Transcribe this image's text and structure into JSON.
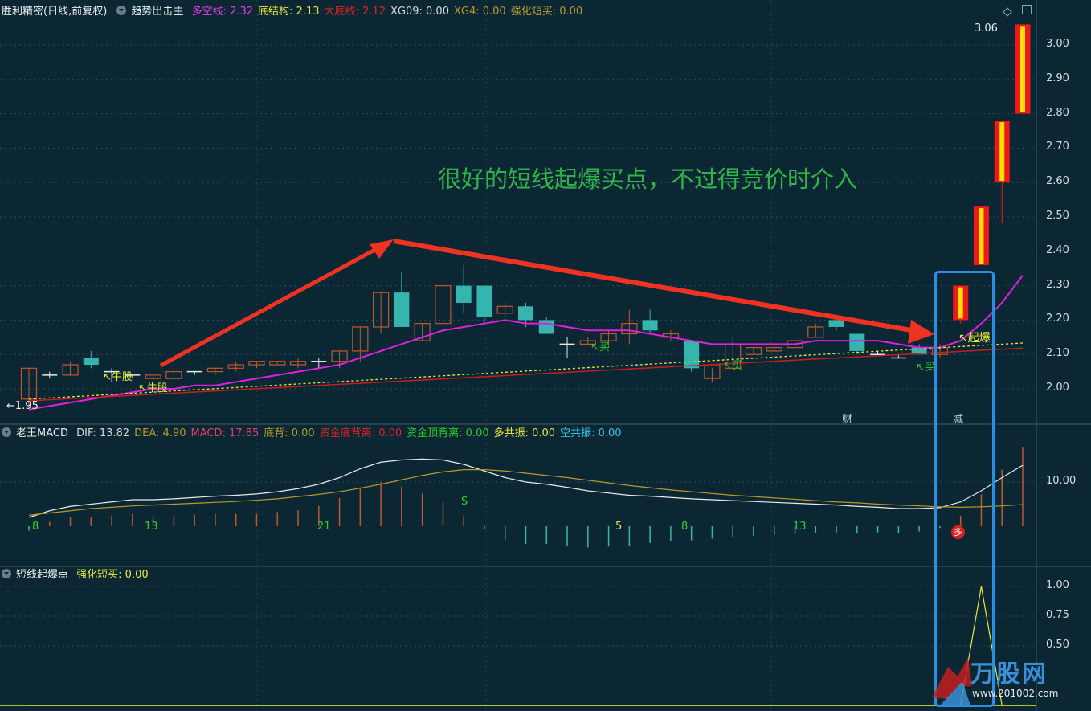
{
  "header_main": {
    "title": "胜利精密(日线,前复权)",
    "indicator": "趋势出击主",
    "items": [
      {
        "label": "多空线:",
        "value": "2.32",
        "color": "#e840e8"
      },
      {
        "label": "底结构:",
        "value": "2.13",
        "color": "#e8e83a"
      },
      {
        "label": "大底线:",
        "value": "2.12",
        "color": "#e02424"
      },
      {
        "label": "XG09:",
        "value": "0.00",
        "color": "#d8d8d8"
      },
      {
        "label": "XG4:",
        "value": "0.00",
        "color": "#b89a2a"
      },
      {
        "label": "强化短买:",
        "value": "0.00",
        "color": "#b89a2a"
      }
    ]
  },
  "header_macd": {
    "title": "老王MACD",
    "items": [
      {
        "label": "DIF:",
        "value": "13.82",
        "color": "#d8d8d8"
      },
      {
        "label": "DEA:",
        "value": "4.90",
        "color": "#b8982a"
      },
      {
        "label": "MACD:",
        "value": "17.85",
        "color": "#e0406e"
      },
      {
        "label": "底背:",
        "value": "0.00",
        "color": "#b89a2a"
      },
      {
        "label": "资金底背离:",
        "value": "0.00",
        "color": "#e02424"
      },
      {
        "label": "资金顶背离:",
        "value": "0.00",
        "color": "#28d028"
      },
      {
        "label": "多共振:",
        "value": "0.00",
        "color": "#e8e83a"
      },
      {
        "label": "空共振:",
        "value": "0.00",
        "color": "#28c8e8"
      }
    ]
  },
  "header_burst": {
    "title": "短线起爆点",
    "items": [
      {
        "label": "强化短买:",
        "value": "0.00",
        "color": "#e8e83a"
      }
    ]
  },
  "price_axis": [
    "3.00",
    "2.90",
    "2.80",
    "2.70",
    "2.60",
    "2.50",
    "2.40",
    "2.30",
    "2.20",
    "2.10",
    "2.00"
  ],
  "macd_axis": [
    "10.00"
  ],
  "burst_axis": [
    "1.00",
    "0.75",
    "0.50"
  ],
  "annotation": "很好的短线起爆买点，不过得竞价时介入",
  "signals": {
    "niu1": "牛股",
    "niu2": "牛股",
    "buy1": "买",
    "buy2": "买",
    "buy3": "买",
    "qibao": "起爆",
    "cai": "财",
    "jian": "减",
    "duo": "多",
    "high": "3.06",
    "low": "1.95"
  },
  "macd_counts": [
    "8",
    "13",
    "21",
    "S",
    "5",
    "8",
    "13"
  ],
  "watermark": {
    "brand": "万股网",
    "url": "www.201002.com"
  },
  "colors": {
    "background": "#0b2734",
    "up": "#c2572c",
    "down": "#36b5ae",
    "limit_up_border": "#f01818",
    "limit_up_fill": "#ffe000",
    "ma_line": "#e020e0",
    "selection_box": "#2a8fe3"
  },
  "chart_data": {
    "type": "candlestick",
    "ylim": [
      1.92,
      3.08
    ],
    "ohlc": [
      [
        1.97,
        2.06,
        1.95,
        2.06
      ],
      [
        2.04,
        2.05,
        2.03,
        2.04
      ],
      [
        2.04,
        2.08,
        2.04,
        2.07
      ],
      [
        2.09,
        2.11,
        2.06,
        2.07
      ],
      [
        2.05,
        2.06,
        2.02,
        2.05
      ],
      [
        2.04,
        2.04,
        2.03,
        2.04
      ],
      [
        2.03,
        2.04,
        2.02,
        2.04
      ],
      [
        2.03,
        2.06,
        2.03,
        2.05
      ],
      [
        2.05,
        2.05,
        2.04,
        2.05
      ],
      [
        2.05,
        2.06,
        2.04,
        2.06
      ],
      [
        2.06,
        2.08,
        2.05,
        2.07
      ],
      [
        2.07,
        2.08,
        2.06,
        2.08
      ],
      [
        2.07,
        2.08,
        2.07,
        2.08
      ],
      [
        2.07,
        2.09,
        2.06,
        2.08
      ],
      [
        2.08,
        2.09,
        2.06,
        2.08
      ],
      [
        2.08,
        2.11,
        2.06,
        2.11
      ],
      [
        2.11,
        2.18,
        2.08,
        2.18
      ],
      [
        2.18,
        2.28,
        2.16,
        2.28
      ],
      [
        2.28,
        2.34,
        2.18,
        2.18
      ],
      [
        2.14,
        2.19,
        2.14,
        2.19
      ],
      [
        2.19,
        2.3,
        2.19,
        2.3
      ],
      [
        2.3,
        2.36,
        2.22,
        2.25
      ],
      [
        2.3,
        2.3,
        2.19,
        2.21
      ],
      [
        2.22,
        2.25,
        2.21,
        2.24
      ],
      [
        2.24,
        2.25,
        2.18,
        2.2
      ],
      [
        2.2,
        2.21,
        2.16,
        2.16
      ],
      [
        2.13,
        2.15,
        2.09,
        2.13
      ],
      [
        2.13,
        2.15,
        2.13,
        2.14
      ],
      [
        2.14,
        2.17,
        2.12,
        2.16
      ],
      [
        2.16,
        2.23,
        2.13,
        2.19
      ],
      [
        2.2,
        2.23,
        2.16,
        2.17
      ],
      [
        2.15,
        2.17,
        2.14,
        2.16
      ],
      [
        2.14,
        2.14,
        2.05,
        2.06
      ],
      [
        2.03,
        2.06,
        2.02,
        2.07
      ],
      [
        2.06,
        2.15,
        2.06,
        2.13
      ],
      [
        2.1,
        2.12,
        2.1,
        2.12
      ],
      [
        2.11,
        2.13,
        2.11,
        2.12
      ],
      [
        2.12,
        2.15,
        2.12,
        2.14
      ],
      [
        2.15,
        2.19,
        2.15,
        2.18
      ],
      [
        2.2,
        2.2,
        2.17,
        2.18
      ],
      [
        2.16,
        2.16,
        2.1,
        2.11
      ],
      [
        2.1,
        2.11,
        2.1,
        2.1
      ],
      [
        2.09,
        2.1,
        2.09,
        2.09
      ],
      [
        2.12,
        2.13,
        2.1,
        2.1
      ],
      [
        2.1,
        2.13,
        2.09,
        2.12
      ],
      [
        2.2,
        2.3,
        2.19,
        2.3
      ],
      [
        2.36,
        2.53,
        2.36,
        2.53
      ],
      [
        2.6,
        2.78,
        2.48,
        2.78
      ],
      [
        2.8,
        3.06,
        2.8,
        3.06
      ]
    ],
    "ma": [
      1.94,
      1.95,
      1.96,
      1.97,
      1.98,
      1.99,
      2.0,
      2.0,
      2.01,
      2.01,
      2.02,
      2.03,
      2.04,
      2.05,
      2.06,
      2.07,
      2.09,
      2.11,
      2.13,
      2.15,
      2.17,
      2.18,
      2.19,
      2.2,
      2.19,
      2.19,
      2.18,
      2.17,
      2.17,
      2.17,
      2.16,
      2.15,
      2.14,
      2.13,
      2.13,
      2.13,
      2.13,
      2.13,
      2.14,
      2.14,
      2.14,
      2.14,
      2.13,
      2.12,
      2.12,
      2.14,
      2.19,
      2.25,
      2.33
    ],
    "macd_dif": [
      2,
      3.5,
      4.5,
      5,
      5.5,
      6,
      6,
      6.2,
      6.5,
      6.8,
      7,
      7.3,
      7.8,
      8.5,
      9.5,
      11,
      13,
      14.5,
      15,
      15.2,
      15,
      14,
      12.5,
      11,
      10,
      9.5,
      8.8,
      8,
      7.5,
      7,
      6.8,
      6.5,
      6.2,
      6,
      5.8,
      5.6,
      5.4,
      5.2,
      5,
      4.8,
      4.5,
      4.3,
      4,
      4,
      4.2,
      5.5,
      8,
      11,
      13.8
    ],
    "macd_dea": [
      2.5,
      3,
      3.5,
      4,
      4.3,
      4.6,
      4.8,
      5,
      5.2,
      5.4,
      5.6,
      5.9,
      6.2,
      6.7,
      7.2,
      7.8,
      8.6,
      9.5,
      10.5,
      11.5,
      12.3,
      12.8,
      12.8,
      12.5,
      12,
      11.5,
      11,
      10.4,
      9.8,
      9.2,
      8.7,
      8.2,
      7.8,
      7.4,
      7,
      6.7,
      6.4,
      6.1,
      5.8,
      5.5,
      5.3,
      5,
      4.8,
      4.6,
      4.4,
      4.3,
      4.4,
      4.6,
      4.9
    ],
    "burst": [
      0,
      0,
      0,
      0,
      0,
      0,
      0,
      0,
      0,
      0,
      0,
      0,
      0,
      0,
      0,
      0,
      0,
      0,
      0,
      0,
      0,
      0,
      0,
      0,
      0,
      0,
      0,
      0,
      0,
      0,
      0,
      0,
      0,
      0,
      0,
      0,
      0,
      0,
      0,
      0,
      0,
      0,
      0,
      0,
      0,
      0,
      1,
      0,
      0
    ]
  }
}
